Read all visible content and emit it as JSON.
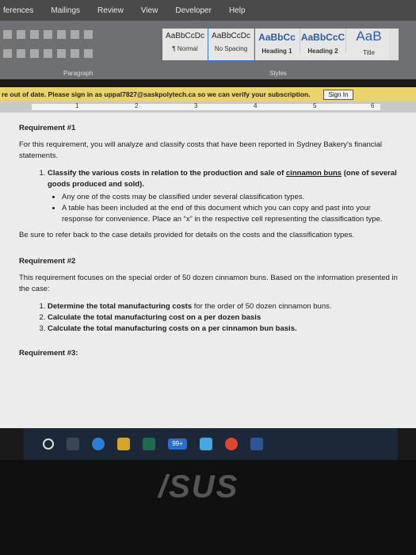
{
  "ribbon_tabs": [
    "ferences",
    "Mailings",
    "Review",
    "View",
    "Developer",
    "Help"
  ],
  "styles": [
    {
      "sample": "AaBbCcDc",
      "name": "¶ Normal"
    },
    {
      "sample": "AaBbCcDc",
      "name": "No Spacing"
    },
    {
      "sample": "AaBbCc",
      "name": "Heading 1"
    },
    {
      "sample": "AaBbCcC",
      "name": "Heading 2"
    },
    {
      "sample": "AaB",
      "name": "Title"
    }
  ],
  "group_labels": {
    "paragraph": "Paragraph",
    "styles": "Styles"
  },
  "notice": {
    "message": "re out of date. Please sign in as uppal7827@saskpolytech.ca so we can verify your subscription.",
    "signin": "Sign In"
  },
  "ruler": {
    "marks": [
      "1",
      "2",
      "3",
      "4",
      "5",
      "6"
    ]
  },
  "doc": {
    "req1_title": "Requirement #1",
    "req1_intro": "For this requirement, you will analyze and classify costs that have been reported in Sydney Bakery's financial statements.",
    "req1_item1_pre": "Classify the various costs in relation to the production and sale of",
    "req1_item1_u": "cinnamon buns",
    "req1_item1_post": "(one of several goods produced and sold).",
    "req1_bullet1": "Any one of the costs may be classified under several classification types.",
    "req1_bullet2": "A table has been included at the end of this document which you can copy and past into your response for convenience. Place an “x” in the respective cell representing the classification type.",
    "req1_note": "Be sure to refer back to the case details provided for details on the costs and the classification types.",
    "req2_title": "Requirement #2",
    "req2_intro": "This requirement focuses on the special order of 50 dozen cinnamon buns. Based on the information presented in the case:",
    "req2_i1_b": "Determine the total manufacturing costs",
    "req2_i1_rest": " for the order of 50 dozen cinnamon buns.",
    "req2_i2_pre": "Calculate the total manufacturing cost on a ",
    "req2_i2_b": "per dozen",
    "req2_i2_post": " basis",
    "req2_i3_pre": "Calculate the total manufacturing costs on a ",
    "req2_i3_b": "per cinnamon bun",
    "req2_i3_post": " basis.",
    "req3_title": "Requirement #3:"
  },
  "taskbar": {
    "badge": "99+"
  },
  "brand": "/SUS"
}
